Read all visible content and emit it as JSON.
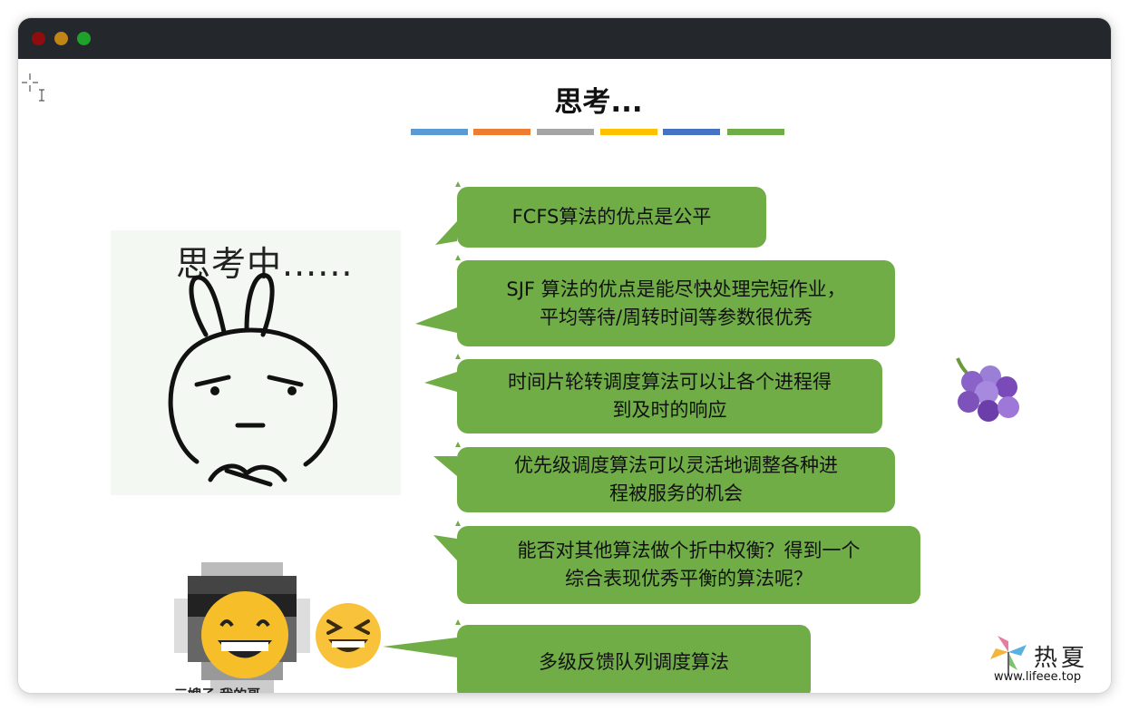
{
  "slide": {
    "title": "思考...",
    "title_bar_colors": [
      "#5b9bd5",
      "#ed7d31",
      "#a5a5a5",
      "#ffc000",
      "#4472c4",
      "#70ad47"
    ]
  },
  "bubbles": [
    {
      "text": "FCFS算法的优点是公平"
    },
    {
      "text": "SJF 算法的优点是能尽快处理完短作业，\n平均等待/周转时间等参数很优秀"
    },
    {
      "text": "时间片轮转调度算法可以让各个进程得\n到及时的响应"
    },
    {
      "text": "优先级调度算法可以灵活地调整各种进\n程被服务的机会"
    },
    {
      "text": "能否对其他算法做个折中权衡？得到一个\n综合表现优秀平衡的算法呢？"
    },
    {
      "text": "多级反馈队列调度算法"
    }
  ],
  "thinking_image": {
    "text": "思考中......"
  },
  "avatar": {
    "caption": "三嫂子  我的哥"
  },
  "watermark": {
    "brand": "热夏",
    "url": "www.lifeee.top"
  },
  "colors": {
    "bubble": "#70ad47",
    "titlebar": "#24282c"
  }
}
